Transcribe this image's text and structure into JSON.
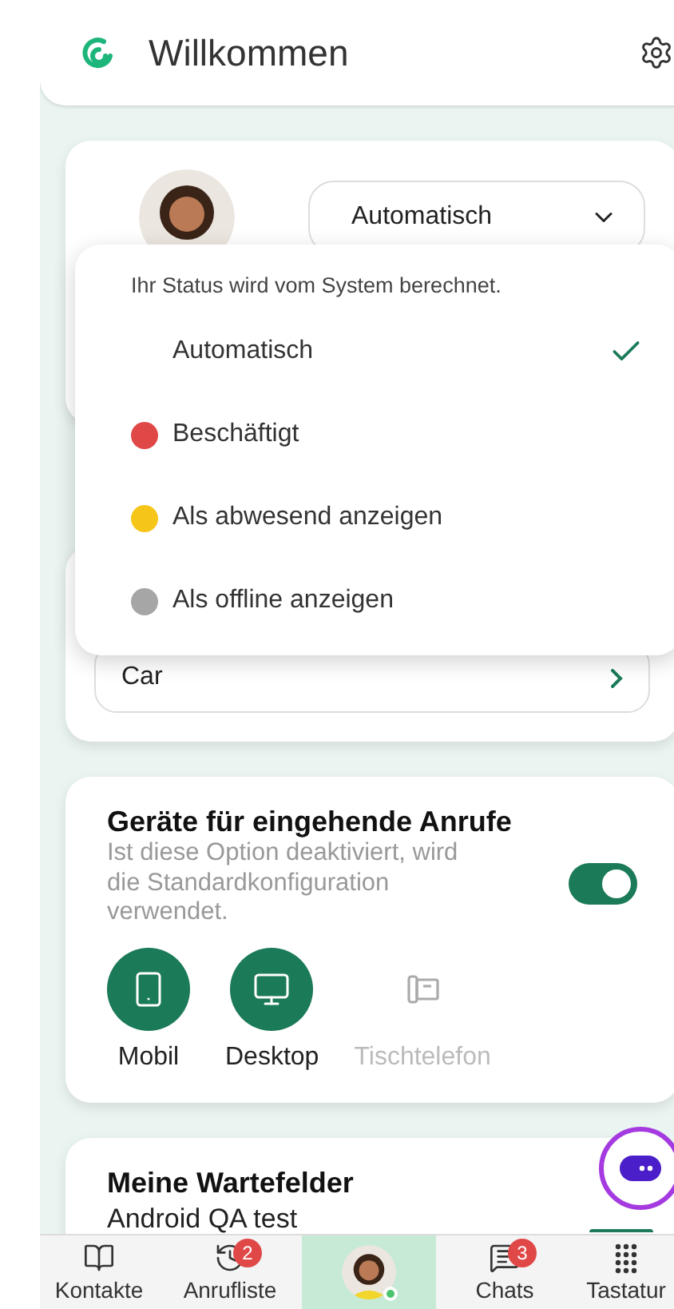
{
  "header": {
    "title": "Willkommen"
  },
  "status_select": {
    "value": "Automatisch"
  },
  "status_menu": {
    "hint": "Ihr Status wird vom System berechnet.",
    "options": [
      {
        "label": "Automatisch",
        "selected": true
      },
      {
        "label": "Beschäftigt",
        "color": "#e04848",
        "selected": false
      },
      {
        "label": "Als abwesend anzeigen",
        "color": "#f5c518",
        "selected": false
      },
      {
        "label": "Als offline anzeigen",
        "color": "#a6a6a6",
        "selected": false
      }
    ]
  },
  "route_field": {
    "value": "Car"
  },
  "incoming": {
    "title": "Geräte für eingehende Anrufe",
    "description": "Ist diese Option deaktiviert, wird die Standardkonfiguration verwendet.",
    "on": true,
    "devices": [
      {
        "kind": "mobile",
        "label": "Mobil",
        "selected": true
      },
      {
        "kind": "desktop",
        "label": "Desktop",
        "selected": true
      },
      {
        "kind": "deskphone",
        "label": "Tischtelefon",
        "selected": false
      }
    ]
  },
  "queues": {
    "title": "Meine Wartefelder",
    "item": "Android QA test",
    "on": true
  },
  "nav": [
    {
      "kind": "contacts",
      "label": "Kontakte",
      "selected": false
    },
    {
      "kind": "history",
      "label": "Anrufliste",
      "badge": "2",
      "selected": false
    },
    {
      "kind": "avatar",
      "selected": true
    },
    {
      "kind": "chats",
      "label": "Chats",
      "badge": "3",
      "selected": false
    },
    {
      "kind": "keypad",
      "label": "Tastatur",
      "selected": false
    }
  ]
}
